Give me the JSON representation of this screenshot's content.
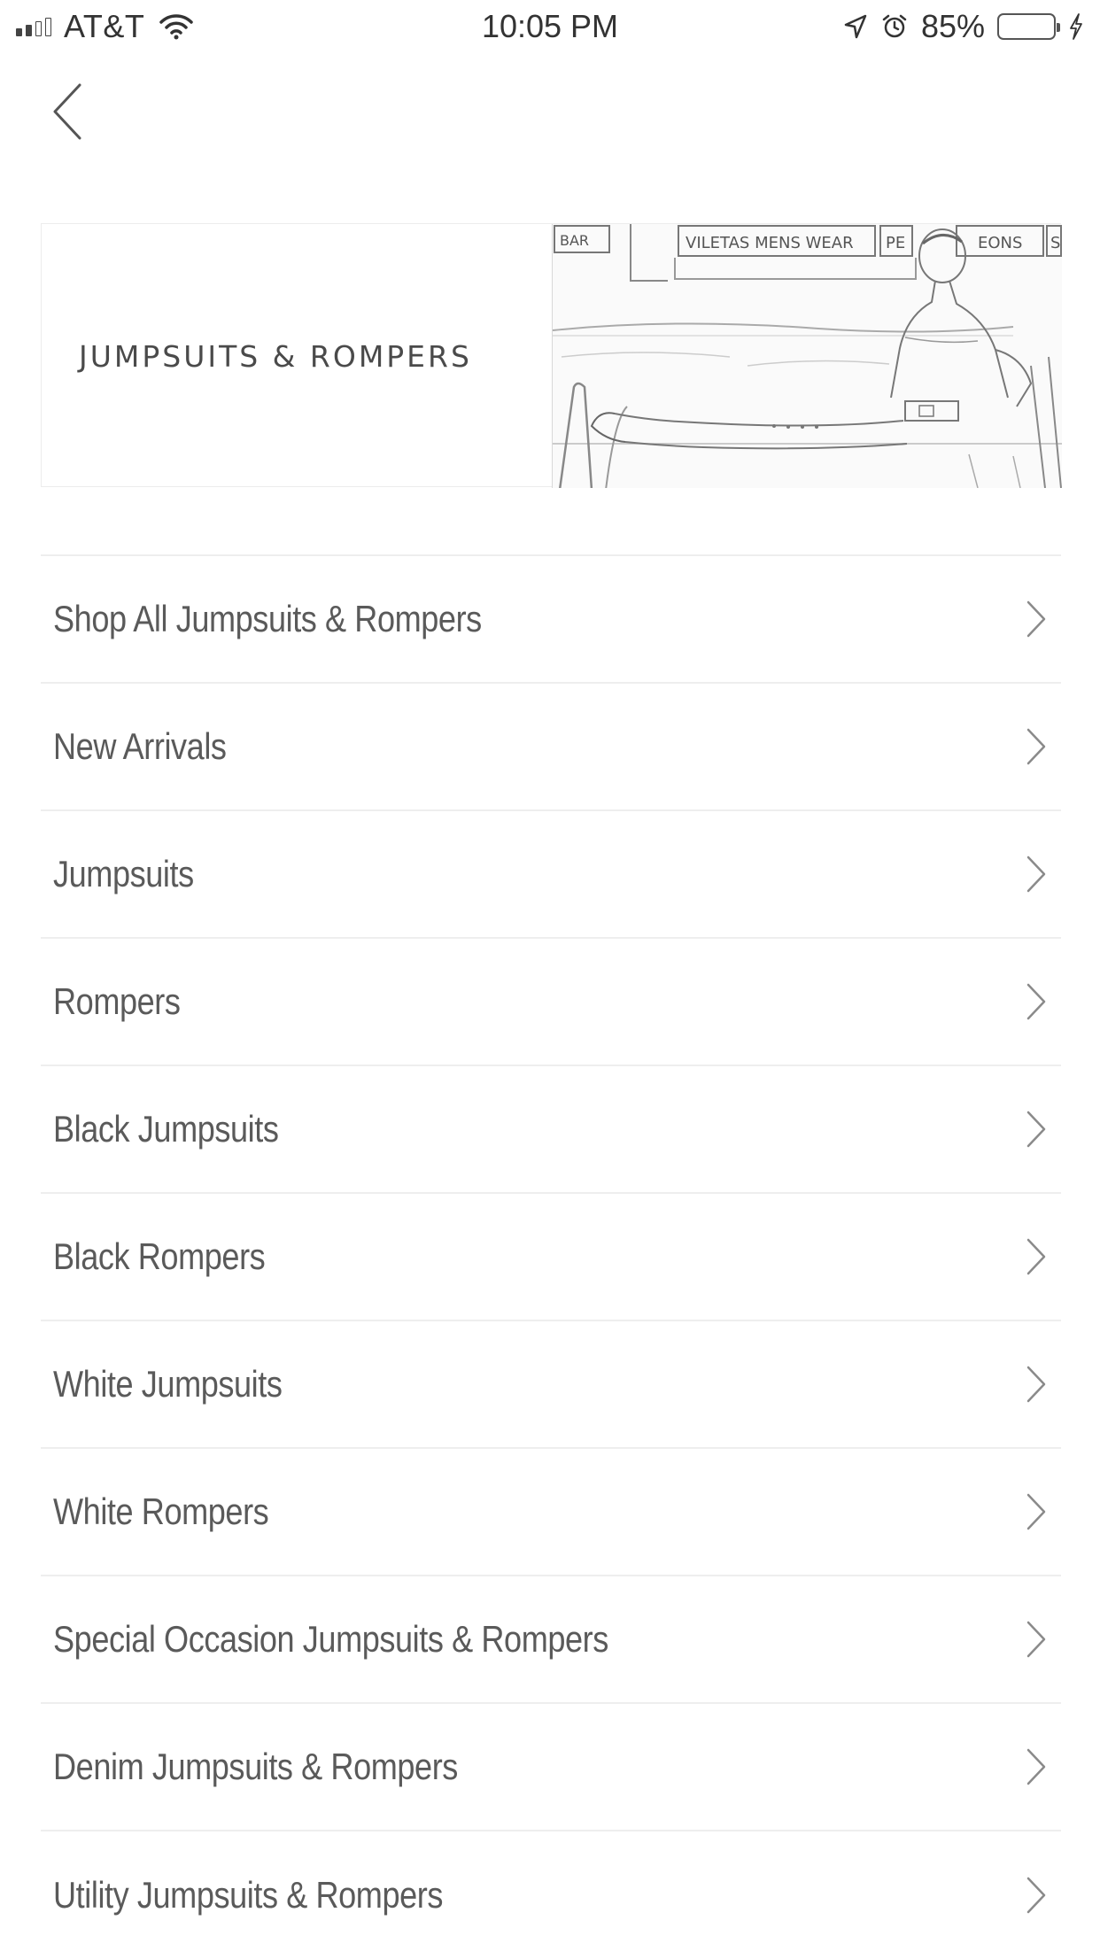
{
  "status_bar": {
    "carrier": "AT&T",
    "time": "10:05 PM",
    "battery_percent": "85%",
    "signal_bars": 2,
    "signal_total": 5,
    "icons": [
      "wifi-icon",
      "location-arrow-icon",
      "alarm-icon",
      "battery-icon",
      "charging-bolt-icon"
    ]
  },
  "navigation": {
    "back_icon": "chevron-left-icon"
  },
  "hero": {
    "title": "JUMPSUITS & ROMPERS",
    "sign_text": [
      "BAR",
      "VILETAS MENS WEAR",
      "PE",
      "EONS",
      "S"
    ]
  },
  "menu": {
    "items": [
      {
        "label": "Shop All Jumpsuits & Rompers"
      },
      {
        "label": "New Arrivals"
      },
      {
        "label": "Jumpsuits"
      },
      {
        "label": "Rompers"
      },
      {
        "label": "Black Jumpsuits"
      },
      {
        "label": "Black Rompers"
      },
      {
        "label": "White Jumpsuits"
      },
      {
        "label": "White Rompers"
      },
      {
        "label": "Special Occasion Jumpsuits & Rompers"
      },
      {
        "label": "Denim Jumpsuits & Rompers"
      },
      {
        "label": "Utility Jumpsuits & Rompers"
      }
    ],
    "chevron_icon": "chevron-right-icon"
  }
}
